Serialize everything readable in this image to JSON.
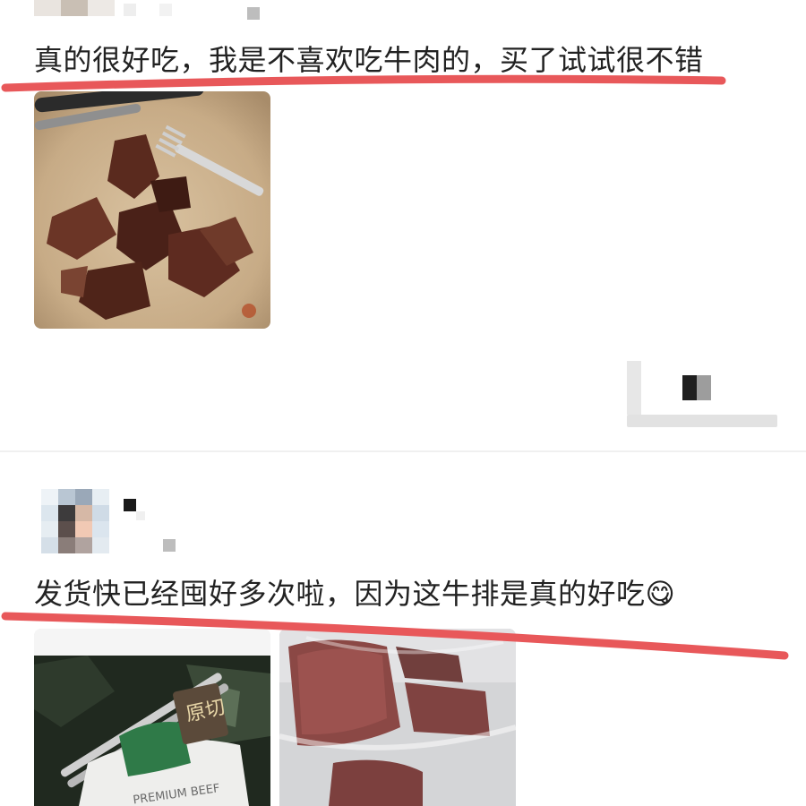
{
  "reviews": [
    {
      "text": "真的很好吃，我是不喜欢吃牛肉的，买了试试很不错",
      "photos": [
        "cooked-beef-plate-photo"
      ]
    },
    {
      "text": "发货快已经囤好多次啦，因为这牛排是真的好吃",
      "emoji": "😋",
      "photos": [
        "beef-package-box-photo",
        "vacuum-sealed-steak-photo"
      ]
    }
  ],
  "colors": {
    "highlight_stroke": "#e8585a",
    "text": "#222222",
    "divider": "#f0f0f0"
  }
}
